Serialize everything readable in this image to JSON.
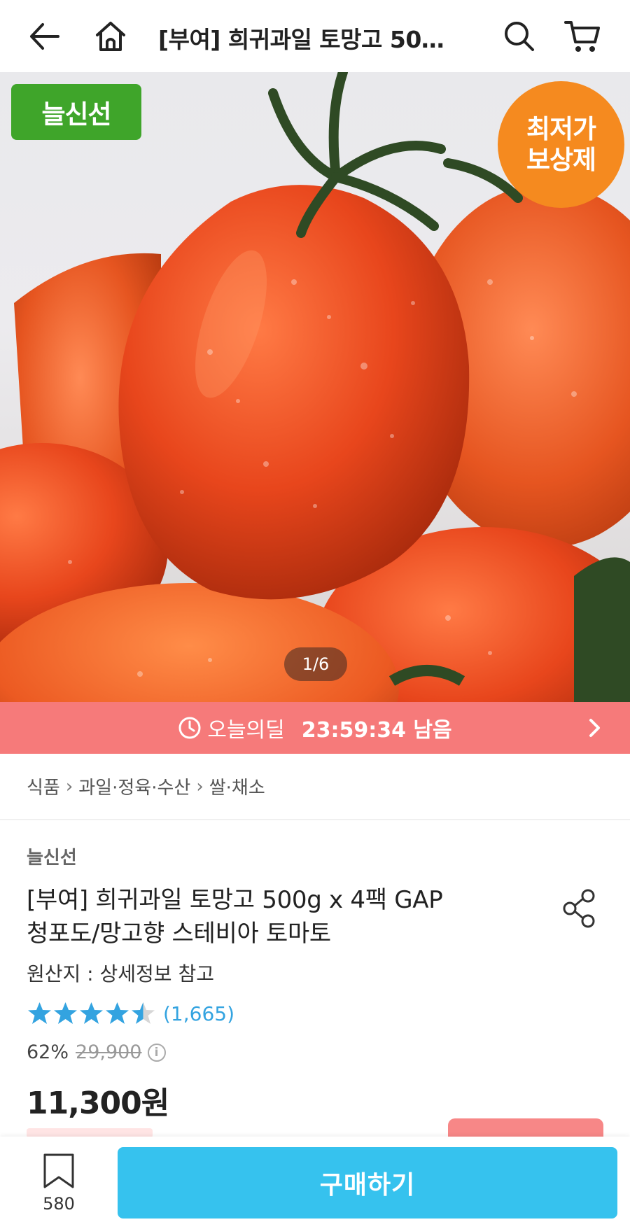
{
  "header": {
    "title": "[부여] 희귀과일 토망고 50…"
  },
  "hero": {
    "badge_left": "늘신선",
    "badge_right_line1": "최저가",
    "badge_right_line2": "보상제",
    "counter": "1/6"
  },
  "deal": {
    "label": "오늘의딜",
    "time": "23:59:34 남음"
  },
  "breadcrumb": [
    "식품",
    "과일·정육·수산",
    "쌀·채소"
  ],
  "product": {
    "seller": "늘신선",
    "title_line1": "[부여] 희귀과일 토망고 500g x 4팩 GAP",
    "title_line2": "청포도/망고향 스테비아 토마토",
    "origin": "원산지 : 상세정보 참고",
    "rating": 4.5,
    "review_count": "(1,665)",
    "discount": "62%",
    "original_price": "29,900",
    "sale_price": "11,300원"
  },
  "bottom": {
    "wish_count": "580",
    "buy_label": "구매하기"
  },
  "colors": {
    "deal_bar": "#f67a7a",
    "buy_button": "#36c2ee",
    "badge_green": "#3fa52a",
    "badge_orange": "#f58a1f",
    "star": "#33a3e0"
  }
}
